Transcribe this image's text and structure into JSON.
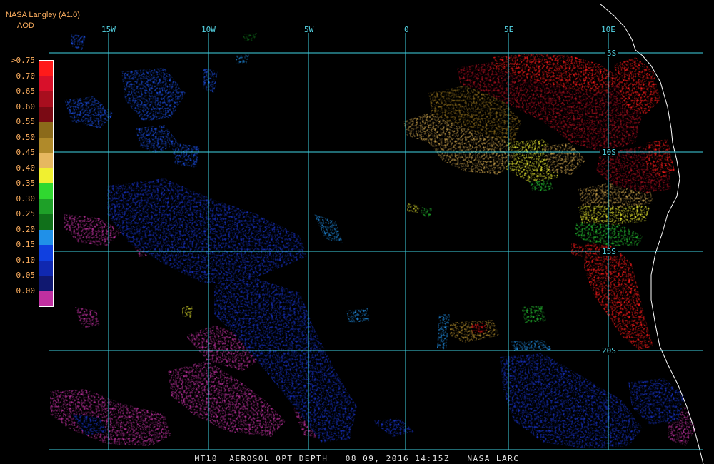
{
  "header": {
    "source": "NASA Langley (A1.0)",
    "product": "AOD"
  },
  "map": {
    "longitude_labels": [
      "15W",
      "10W",
      "5W",
      "0",
      "5E",
      "10E"
    ],
    "latitude_labels": [
      "5S",
      "10S",
      "15S",
      "20S"
    ],
    "gridline_color": "#3fd3e4",
    "coastline_color": "#ffffff",
    "background_color": "#000000"
  },
  "legend": {
    "ticks": [
      ">0.75",
      "0.70",
      "0.65",
      "0.60",
      "0.55",
      "0.50",
      "0.45",
      "0.40",
      "0.35",
      "0.30",
      "0.25",
      "0.20",
      "0.15",
      "0.10",
      "0.05",
      "0.00"
    ],
    "colors": [
      "#ff1a1a",
      "#d8102a",
      "#a80e1e",
      "#7a0a14",
      "#8b6a1a",
      "#b08a2a",
      "#e6b860",
      "#f0f030",
      "#30d830",
      "#1ea028",
      "#10701a",
      "#2090e8",
      "#1040e0",
      "#1028b0",
      "#101870",
      "#c030a0"
    ]
  },
  "footer": {
    "text": "MT10  AEROSOL OPT DEPTH   08 09, 2016 14:15Z   NASA LARC"
  }
}
